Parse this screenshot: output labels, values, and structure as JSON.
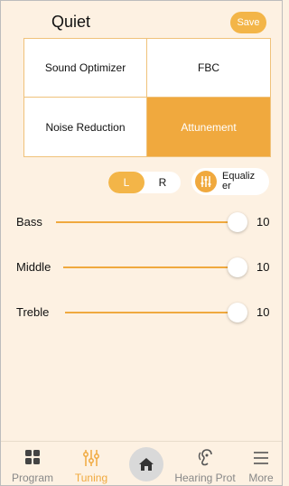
{
  "header": {
    "title": "Quiet",
    "save_label": "Save"
  },
  "grid": {
    "items": [
      {
        "label": "Sound Optimizer",
        "active": false
      },
      {
        "label": "FBC",
        "active": false
      },
      {
        "label": "Noise Reduction",
        "active": false
      },
      {
        "label": "Attunement",
        "active": true
      }
    ]
  },
  "ear_toggle": {
    "left": "L",
    "right": "R",
    "selected": "L"
  },
  "equalizer": {
    "label": "Equalizer"
  },
  "sliders": [
    {
      "label": "Bass",
      "value": "10"
    },
    {
      "label": "Middle",
      "value": "10"
    },
    {
      "label": "Treble",
      "value": "10"
    }
  ],
  "nav": {
    "program": "Program",
    "tuning": "Tuning",
    "hearing": "Hearing Prot",
    "more": "More"
  },
  "colors": {
    "accent": "#f0a93e",
    "background": "#fdf1e2"
  }
}
